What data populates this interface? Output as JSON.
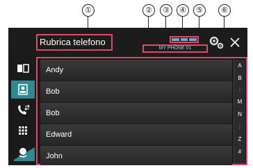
{
  "callouts": [
    "①",
    "②",
    "③",
    "④",
    "⑤",
    "⑥"
  ],
  "header": {
    "title": "Rubrica telefono",
    "device_name": "MY PHONE 01"
  },
  "sidebar": {
    "items": [
      {
        "icon": "contacts-book-icon",
        "active": false
      },
      {
        "icon": "phonebook-icon",
        "active": true
      },
      {
        "icon": "call-history-icon",
        "active": false
      },
      {
        "icon": "dial-pad-icon",
        "active": false
      },
      {
        "icon": "voice-recognition-icon",
        "active": false
      }
    ]
  },
  "contacts": [
    "Andy",
    "Bob",
    "Bob",
    "Edward",
    "John"
  ],
  "index": [
    "A",
    "B",
    ":",
    "M",
    "N",
    ":",
    "Z",
    "#"
  ],
  "colors": {
    "highlight": "#e24a6a",
    "accent": "#2d8a93",
    "background": "#1a1a1a"
  }
}
